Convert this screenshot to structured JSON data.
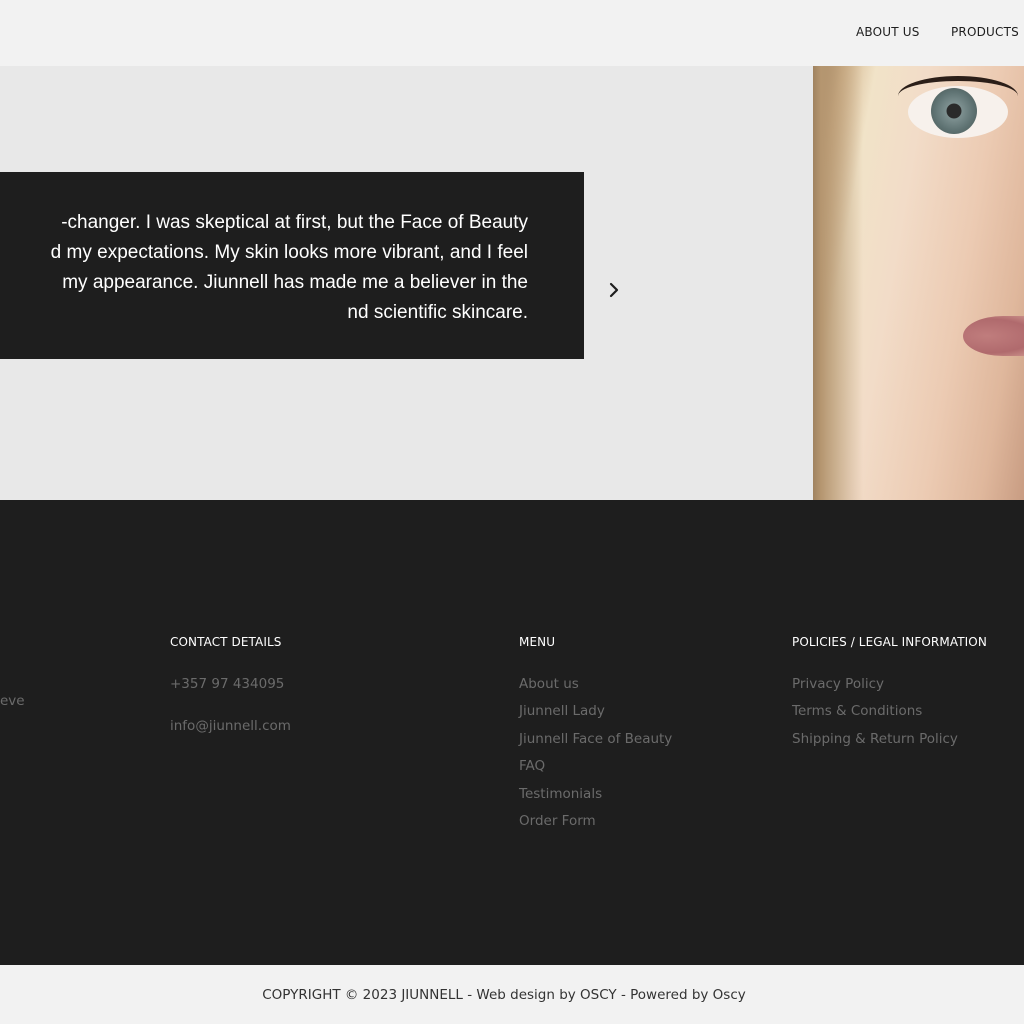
{
  "nav": {
    "about_label": "ABOUT US",
    "products_label": "PRODUCTS"
  },
  "testimonial": {
    "lines": [
      "-changer. I was skeptical at first, but the Face of Beauty",
      "d my expectations. My skin looks more vibrant, and I feel",
      "my appearance. Jiunnell has made me a believer in the",
      "nd scientific skincare."
    ],
    "next_icon": "chevron-right-icon"
  },
  "footer": {
    "left_truncated_text": "eve",
    "contact": {
      "heading": "CONTACT DETAILS",
      "phone": "+357 97 434095",
      "email": "info@jiunnell.com"
    },
    "menu": {
      "heading": "MENU",
      "items": [
        "About us",
        "Jiunnell Lady",
        "Jiunnell Face of Beauty",
        "FAQ",
        "Testimonials",
        "Order Form"
      ]
    },
    "policies": {
      "heading": "POLICIES / LEGAL INFORMATION",
      "items": [
        "Privacy Policy",
        "Terms & Conditions",
        "Shipping & Return Policy"
      ]
    }
  },
  "copyright": {
    "text": "COPYRIGHT © 2023 JIUNNELL - Web design by OSCY - Powered by Oscy"
  },
  "colors": {
    "dark": "#1e1e1e",
    "light_bg": "#f2f2f2",
    "hero_bg": "#e8e8e8",
    "footer_link": "#6b6b6b"
  }
}
